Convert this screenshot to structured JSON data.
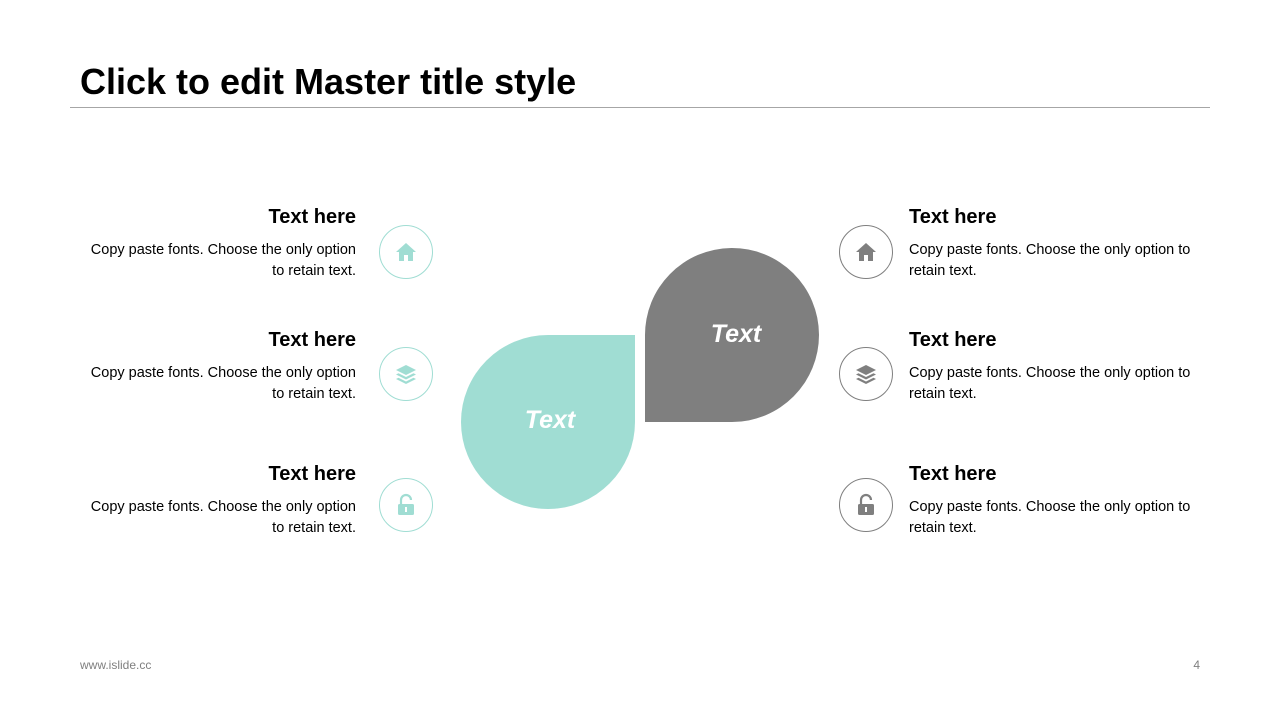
{
  "slide": {
    "title": "Click to edit Master title style",
    "footer_url": "www.islide.cc",
    "page_number": "4"
  },
  "colors": {
    "accent_teal": "#a0ddd3",
    "accent_gray": "#7f7f7f",
    "rule": "#a6a6a6"
  },
  "center": {
    "teal_label": "Text",
    "gray_label": "Text"
  },
  "left_items": [
    {
      "heading": "Text here",
      "body": "Copy paste fonts. Choose the only option to retain text.",
      "icon": "home-icon"
    },
    {
      "heading": "Text here",
      "body": "Copy paste fonts. Choose the only option to retain text.",
      "icon": "layers-icon"
    },
    {
      "heading": "Text here",
      "body": "Copy paste fonts. Choose the only option to retain text.",
      "icon": "unlock-icon"
    }
  ],
  "right_items": [
    {
      "heading": "Text here",
      "body": "Copy paste fonts. Choose the only option to retain text.",
      "icon": "home-icon"
    },
    {
      "heading": "Text here",
      "body": "Copy paste fonts. Choose the only option to retain text.",
      "icon": "layers-icon"
    },
    {
      "heading": "Text here",
      "body": "Copy paste fonts. Choose the only option to retain text.",
      "icon": "unlock-icon"
    }
  ]
}
